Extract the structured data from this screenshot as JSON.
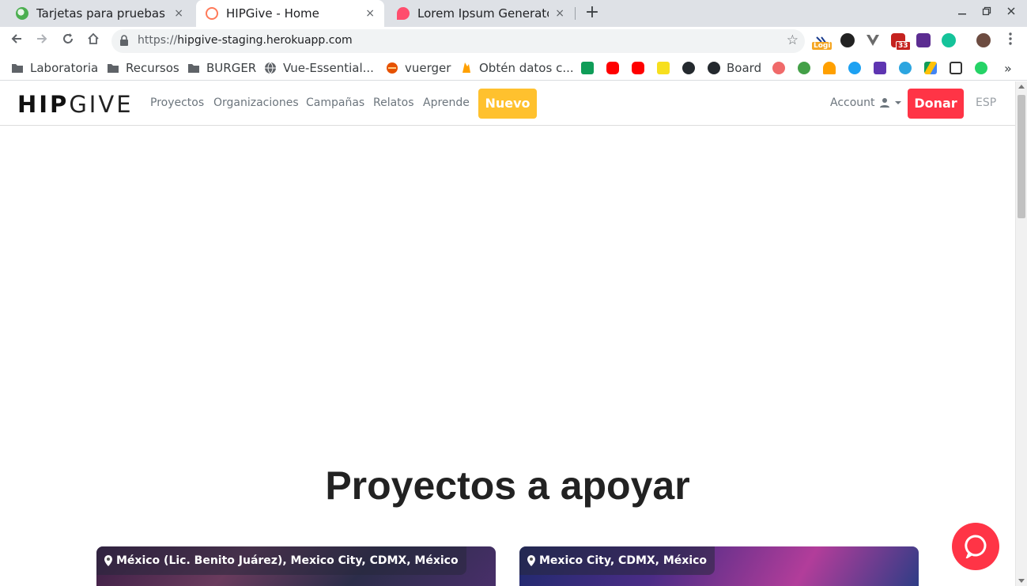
{
  "browser": {
    "tabs": [
      {
        "title": "Tarjetas para pruebas",
        "active": false
      },
      {
        "title": "HIPGive - Home",
        "active": true
      },
      {
        "title": "Lorem Ipsum Generator",
        "active": false
      }
    ],
    "close_glyph": "×",
    "new_tab_glyph": "+",
    "url_scheme": "https://",
    "url_host": "hipgive-staging.herokuapp.com",
    "extension_badges": {
      "logi": "Logi",
      "mail_count": "33"
    },
    "bookmarks": [
      {
        "label": "Laboratoria"
      },
      {
        "label": "Recursos"
      },
      {
        "label": "BURGER"
      },
      {
        "label": "Vue-Essential..."
      },
      {
        "label": "vuerger"
      },
      {
        "label": "Obtén datos c..."
      },
      {
        "label": "Board"
      }
    ],
    "more_glyph": "»"
  },
  "site": {
    "logo_bold": "HIP",
    "logo_thin": "GIVE",
    "nav": [
      "Proyectos",
      "Organizaciones",
      "Campañas",
      "Relatos",
      "Aprende"
    ],
    "nuevo_label": "Nuevo",
    "account_label": "Account",
    "donar_label": "Donar",
    "lang_label": "ESP",
    "section_title": "Proyectos a apoyar",
    "cards": [
      {
        "location": "México (Lic. Benito Juárez), Mexico City, CDMX, México"
      },
      {
        "location": "Mexico City, CDMX, México"
      }
    ]
  },
  "colors": {
    "nuevo": "#ffc12e",
    "donar": "#ff3446",
    "chat": "#ff3446"
  }
}
